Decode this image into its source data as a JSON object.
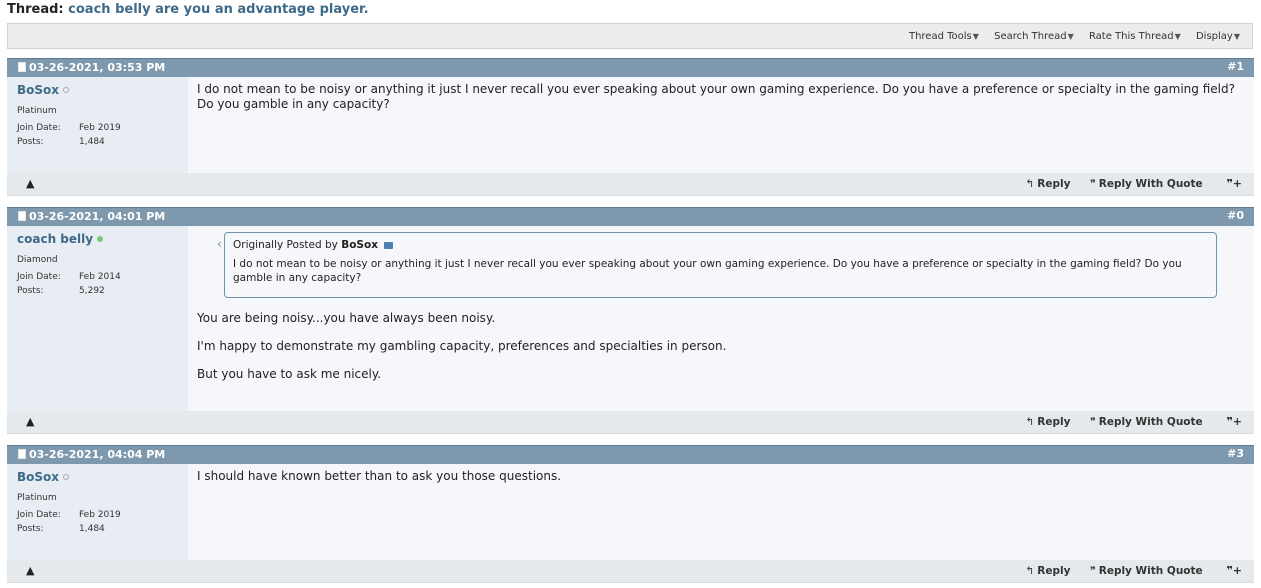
{
  "thread": {
    "prefix": "Thread:",
    "title": "coach belly are you an advantage player."
  },
  "toolbar": {
    "thread_tools": "Thread Tools",
    "search_thread": "Search Thread",
    "rate_thread": "Rate This Thread",
    "display": "Display"
  },
  "actions": {
    "reply": "Reply",
    "reply_with_quote": "Reply With Quote"
  },
  "posts": [
    {
      "date": "03-26-2021, 03:53 PM",
      "number": "#1",
      "user": "BoSox",
      "rank": "Platinum",
      "join_label": "Join Date:",
      "join_date": "Feb 2019",
      "posts_label": "Posts:",
      "posts_count": "1,484",
      "body": "I do not mean to be noisy or anything it just I never recall you ever speaking about your own gaming experience. Do you have a preference or specialty in the gaming field? Do you gamble in any capacity?"
    },
    {
      "date": "03-26-2021, 04:01 PM",
      "number": "#0",
      "user": "coach belly",
      "rank": "Diamond",
      "join_label": "Join Date:",
      "join_date": "Feb 2014",
      "posts_label": "Posts:",
      "posts_count": "5,292",
      "quote_prefix": "Originally Posted by",
      "quote_author": "BoSox",
      "quote_text": "I do not mean to be noisy or anything it just I never recall you ever speaking about your own gaming experience. Do you have a preference or specialty in the gaming field? Do you gamble in any capacity?",
      "lines": [
        "You are being noisy...you have always been noisy.",
        "I'm happy to demonstrate my gambling capacity, preferences and specialties in person.",
        "But you have to ask me nicely."
      ]
    },
    {
      "date": "03-26-2021, 04:04 PM",
      "number": "#3",
      "user": "BoSox",
      "rank": "Platinum",
      "join_label": "Join Date:",
      "join_date": "Feb 2019",
      "posts_label": "Posts:",
      "posts_count": "1,484",
      "body": "I should have known better than to ask you those questions."
    }
  ]
}
